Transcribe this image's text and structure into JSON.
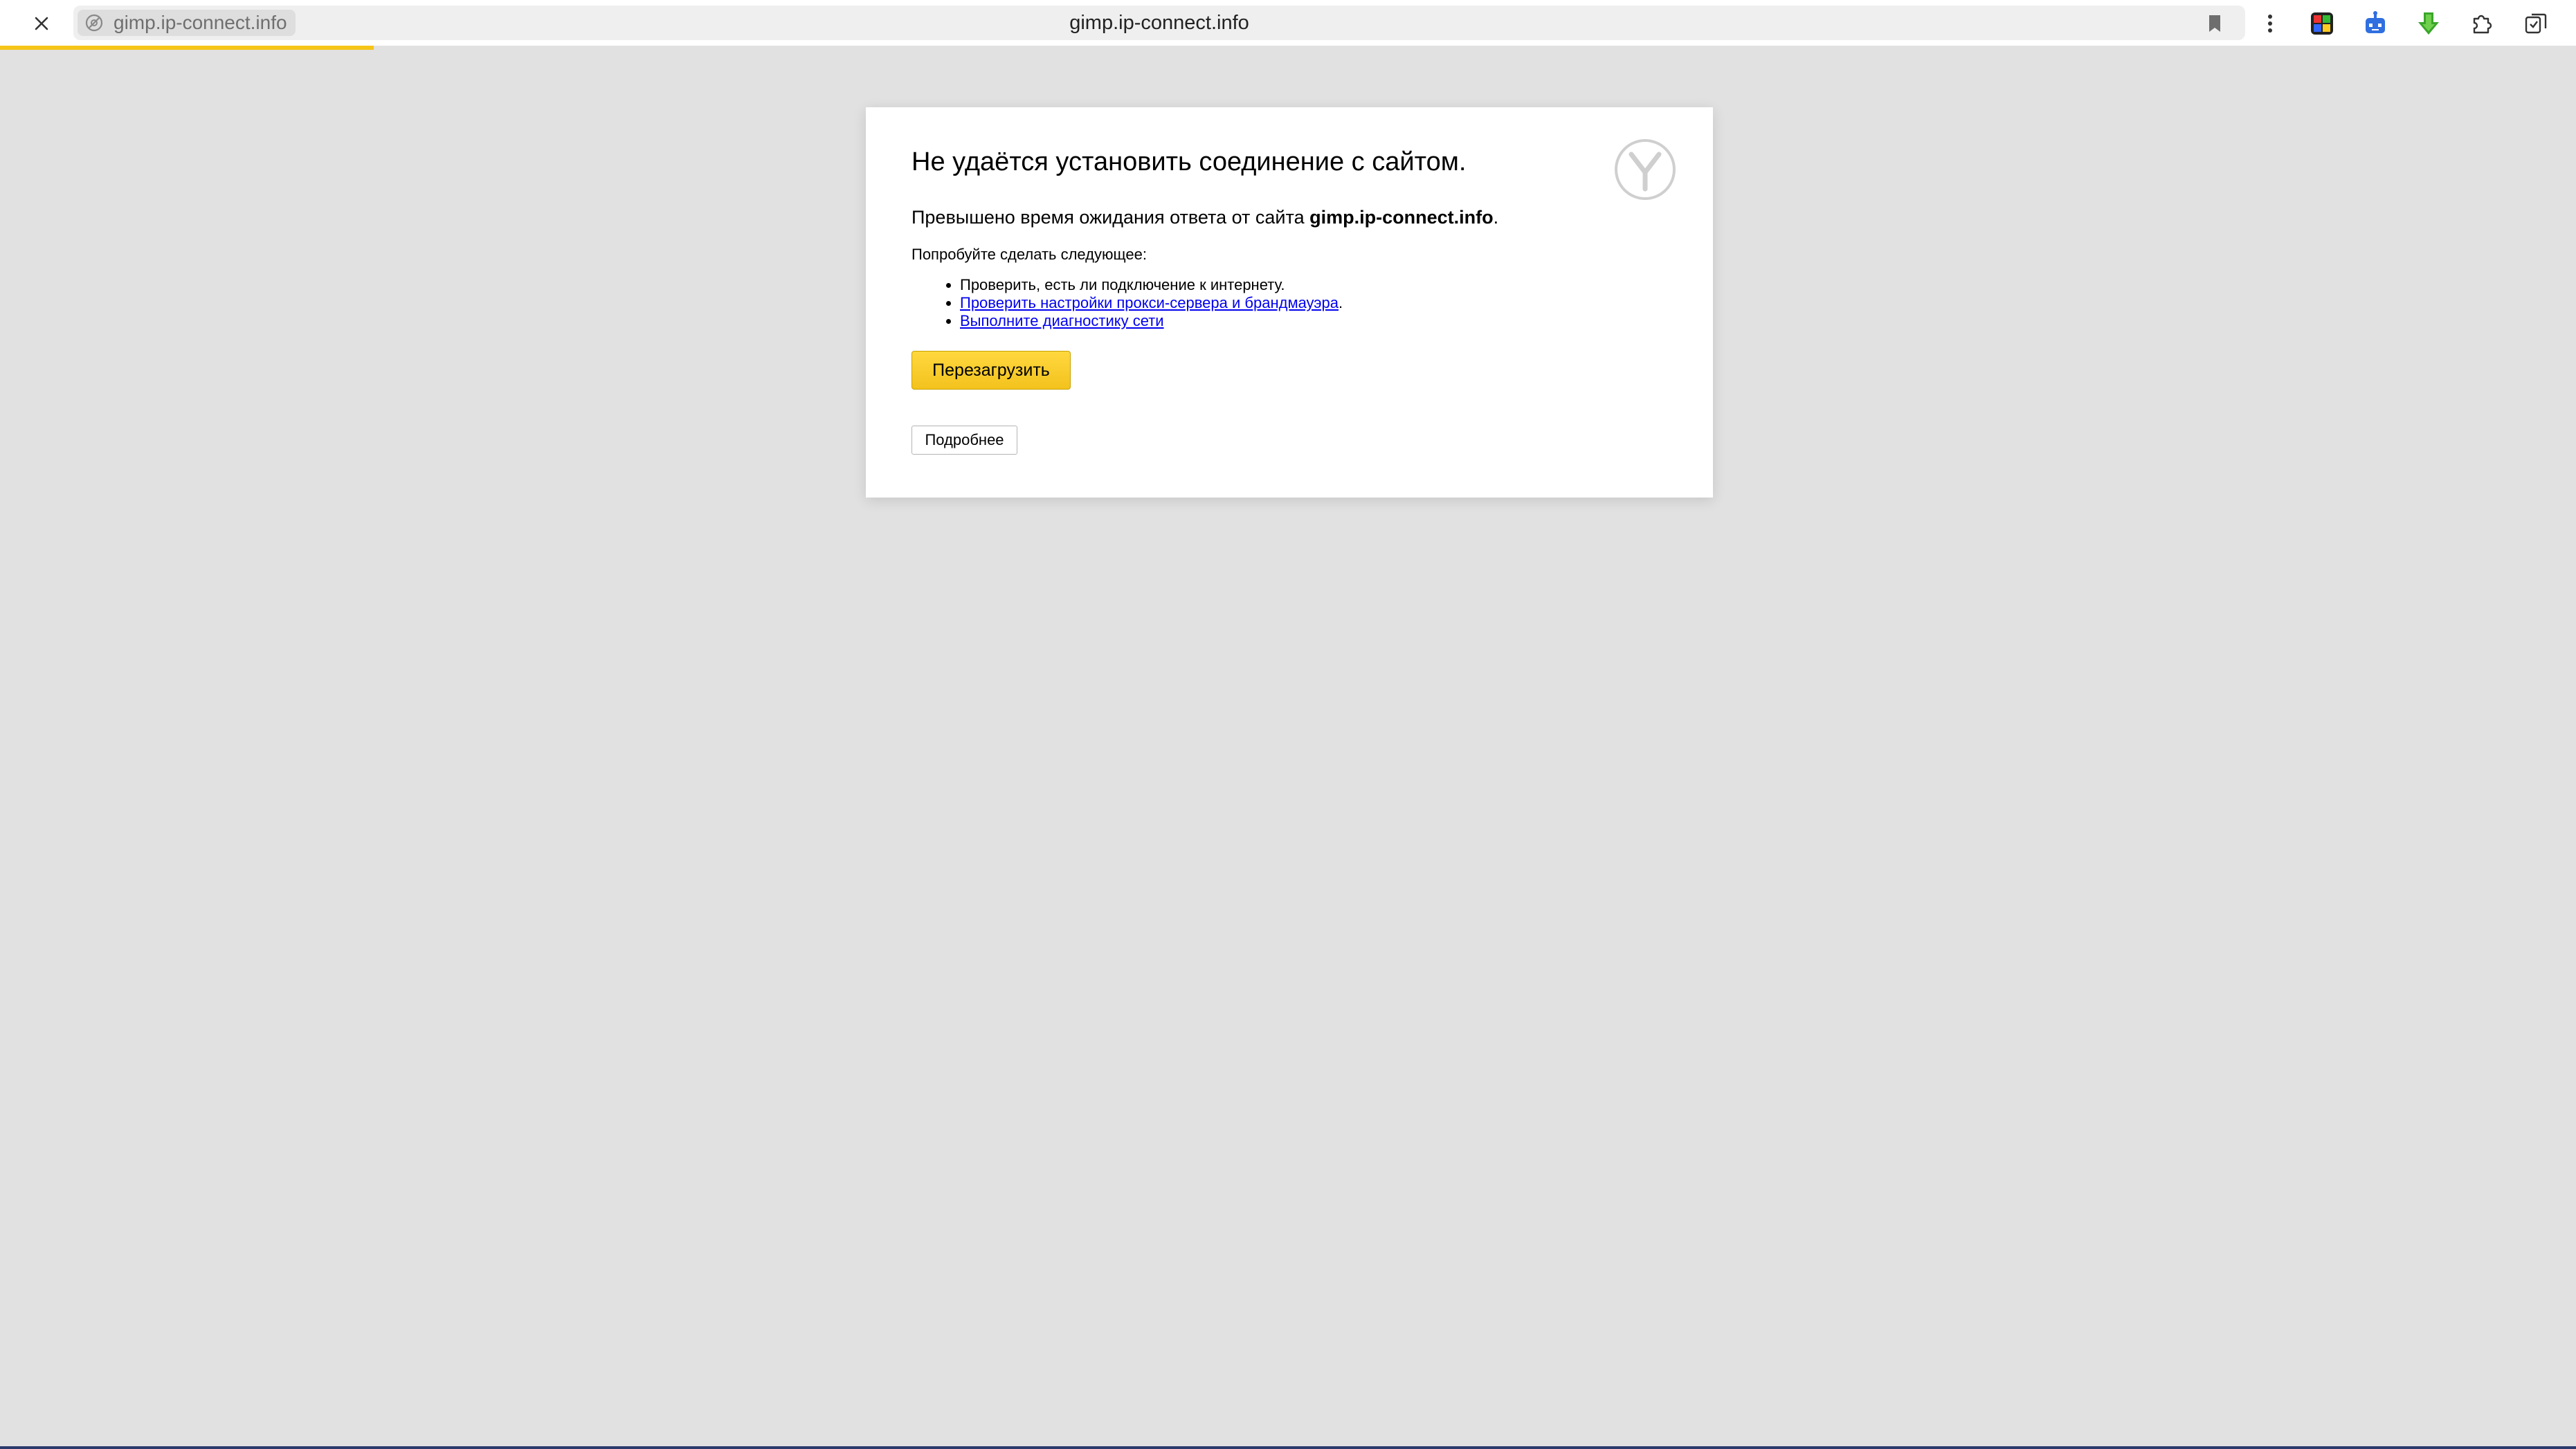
{
  "browser": {
    "domain_chip": "gimp.ip-connect.info",
    "page_title": "gimp.ip-connect.info",
    "load_progress": 0.145,
    "icons": [
      "close-icon",
      "no-connection-icon",
      "bookmark-icon",
      "menu-dots-icon",
      "extension-colorful-icon",
      "extension-robot-icon",
      "download-arrow-icon",
      "puzzle-extensions-icon",
      "collections-icon"
    ]
  },
  "error_page": {
    "title": "Не удаётся установить соединение с сайтом.",
    "description_prefix": "Превышено время ожидания ответа от сайта ",
    "description_host": "gimp.ip-connect.info",
    "description_suffix": ".",
    "try_label": "Попробуйте сделать следующее:",
    "suggestions": [
      {
        "text": "Проверить, есть ли подключение к интернету.",
        "link": false,
        "suffix": ""
      },
      {
        "text": "Проверить настройки прокси-сервера и брандмауэра",
        "link": true,
        "suffix": "."
      },
      {
        "text": "Выполните диагностику сети",
        "link": true,
        "suffix": ""
      }
    ],
    "reload_label": "Перезагрузить",
    "details_label": "Подробнее"
  },
  "colors": {
    "background": "#e1e1e1",
    "accent_yellow": "#f5c518",
    "link": "#0000ee"
  }
}
